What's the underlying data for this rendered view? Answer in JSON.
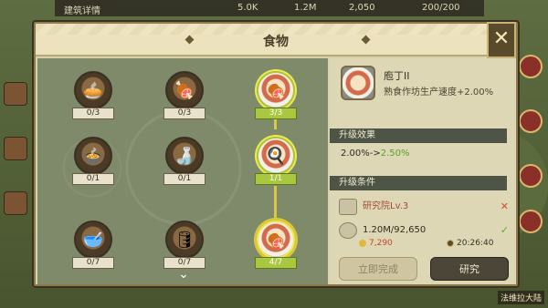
{
  "background": {
    "top_resources": [
      "5.0K",
      "1.2M",
      "2,050",
      "200/200"
    ],
    "top_left_text": "建筑详情",
    "bottom_right_text": "法维拉大陆"
  },
  "modal": {
    "title": "食物",
    "close_icon": "close-x-icon"
  },
  "tree": {
    "nodes": [
      {
        "level": "0/3",
        "icon": "cake-dish-icon",
        "state": "locked"
      },
      {
        "level": "0/3",
        "icon": "barrel-food-icon",
        "state": "locked"
      },
      {
        "level": "3/3",
        "icon": "ham-plate-icon",
        "state": "complete"
      },
      {
        "level": "0/1",
        "icon": "soup-pot-icon",
        "state": "locked"
      },
      {
        "level": "0/1",
        "icon": "bottle-icon",
        "state": "locked"
      },
      {
        "level": "1/1",
        "icon": "fried-egg-icon",
        "state": "complete"
      },
      {
        "level": "0/7",
        "icon": "soup-bowl-icon",
        "state": "locked"
      },
      {
        "level": "0/7",
        "icon": "wine-barrel-icon",
        "state": "locked"
      },
      {
        "level": "4/7",
        "icon": "ham-plate-icon",
        "state": "selected"
      }
    ],
    "scroll_icon": "chevron-down-icon"
  },
  "panel": {
    "name": "庖丁II",
    "description": "熟食作坊生产速度+2.00%",
    "effect_header": "升级效果",
    "effect_from": "2.00%->",
    "effect_to": "2.50%",
    "conditions_header": "升级条件",
    "conditions": [
      {
        "label": "研究院Lv.3",
        "status": "✕",
        "met": false,
        "icon": "research-building-icon"
      },
      {
        "label": "1.20M/92,650",
        "status": "✓",
        "met": true,
        "icon": "silver-coin-icon"
      }
    ]
  },
  "footer": {
    "gold_cost": "7,290",
    "time_cost": "20:26:40",
    "finish_button": "立即完成",
    "research_button": "研究"
  },
  "colors": {
    "accent_green": "#a9c83f",
    "fail_red": "#d24b3a",
    "ok_green": "#6aa433"
  }
}
